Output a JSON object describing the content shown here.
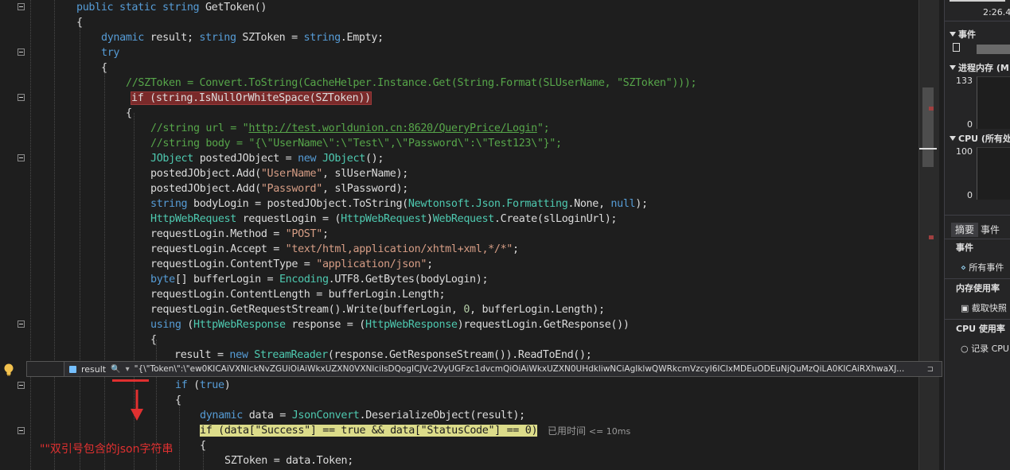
{
  "editor": {
    "lines": [
      [
        [
          "k",
          "public static "
        ],
        [
          "k",
          "string "
        ],
        [
          "p",
          "GetToken()"
        ]
      ],
      [
        [
          "p",
          "{"
        ]
      ],
      [
        [
          "k",
          "dynamic "
        ],
        [
          "p",
          "result; "
        ],
        [
          "k",
          "string "
        ],
        [
          "p",
          "SZToken = "
        ],
        [
          "k",
          "string"
        ],
        [
          "p",
          ".Empty;"
        ]
      ],
      [
        [
          "k",
          "try"
        ]
      ],
      [
        [
          "p",
          "{"
        ]
      ],
      [
        [
          "c",
          "//SZToken = Convert.ToString(CacheHelper.Instance.Get(String.Format(SLUserName, \"SZToken\")));"
        ]
      ],
      [
        [
          "hr",
          "if (string.IsNullOrWhiteSpace(SZToken))"
        ]
      ],
      [
        [
          "p",
          "{"
        ]
      ],
      [
        [
          "c",
          "//string url = \""
        ],
        [
          "u",
          "http://test.worldunion.cn:8620/QueryPrice/Login"
        ],
        [
          "c",
          "\";"
        ]
      ],
      [
        [
          "c",
          "//string body = \"{\\\"UserName\\\":\\\"Test\\\",\\\"Password\\\":\\\"Test123\\\"}\";"
        ]
      ],
      [
        [
          "t",
          "JObject "
        ],
        [
          "p",
          "postedJObject = "
        ],
        [
          "k",
          "new "
        ],
        [
          "t",
          "JObject"
        ],
        [
          "p",
          "();"
        ]
      ],
      [
        [
          "p",
          "postedJObject.Add("
        ],
        [
          "s",
          "\"UserName\""
        ],
        [
          "p",
          ", slUserName);"
        ]
      ],
      [
        [
          "p",
          "postedJObject.Add("
        ],
        [
          "s",
          "\"Password\""
        ],
        [
          "p",
          ", slPassword);"
        ]
      ],
      [
        [
          "k",
          "string "
        ],
        [
          "p",
          "bodyLogin = postedJObject.ToString("
        ],
        [
          "t",
          "Newtonsoft.Json.Formatting"
        ],
        [
          "p",
          ".None, "
        ],
        [
          "k",
          "null"
        ],
        [
          "p",
          ");"
        ]
      ],
      [
        [
          "t",
          "HttpWebRequest "
        ],
        [
          "p",
          "requestLogin = ("
        ],
        [
          "t",
          "HttpWebRequest"
        ],
        [
          "p",
          ")"
        ],
        [
          "t",
          "WebRequest"
        ],
        [
          "p",
          ".Create(slLoginUrl);"
        ]
      ],
      [
        [
          "p",
          "requestLogin.Method = "
        ],
        [
          "s",
          "\"POST\""
        ],
        [
          "p",
          ";"
        ]
      ],
      [
        [
          "p",
          "requestLogin.Accept = "
        ],
        [
          "s",
          "\"text/html,application/xhtml+xml,*/*\""
        ],
        [
          "p",
          ";"
        ]
      ],
      [
        [
          "p",
          "requestLogin.ContentType = "
        ],
        [
          "s",
          "\"application/json\""
        ],
        [
          "p",
          ";"
        ]
      ],
      [
        [
          "k",
          "byte"
        ],
        [
          "p",
          "[] bufferLogin = "
        ],
        [
          "t",
          "Encoding"
        ],
        [
          "p",
          ".UTF8.GetBytes(bodyLogin);"
        ]
      ],
      [
        [
          "p",
          "requestLogin.ContentLength = bufferLogin.Length;"
        ]
      ],
      [
        [
          "p",
          "requestLogin.GetRequestStream().Write(bufferLogin, "
        ],
        [
          "n",
          "0"
        ],
        [
          "p",
          ", bufferLogin.Length);"
        ]
      ],
      [
        [
          "k",
          "using "
        ],
        [
          "p",
          "("
        ],
        [
          "t",
          "HttpWebResponse "
        ],
        [
          "p",
          "response = ("
        ],
        [
          "t",
          "HttpWebResponse"
        ],
        [
          "p",
          ")requestLogin.GetResponse())"
        ]
      ],
      [
        [
          "p",
          "{"
        ]
      ],
      [
        [
          "p",
          "result = "
        ],
        [
          "k",
          "new "
        ],
        [
          "t",
          "StreamReader"
        ],
        [
          "p",
          "(response.GetResponseStream()).ReadToEnd();"
        ]
      ],
      [],
      [
        [
          "k",
          "if "
        ],
        [
          "p",
          "("
        ],
        [
          "k",
          "true"
        ],
        [
          "p",
          ")"
        ]
      ],
      [
        [
          "p",
          "{"
        ]
      ],
      [
        [
          "k",
          "dynamic "
        ],
        [
          "p",
          "data = "
        ],
        [
          "t",
          "JsonConvert"
        ],
        [
          "p",
          ".DeserializeObject(result);"
        ]
      ],
      [
        [
          "hy",
          "if (data[\"Success\"] == true && data[\"StatusCode\"] == 0)"
        ]
      ],
      [
        [
          "p",
          "{"
        ]
      ],
      [
        [
          "p",
          "SZToken = data.Token;"
        ]
      ]
    ],
    "elapsed_label": "已用时间",
    "elapsed_value": "<= 10ms"
  },
  "datatip": {
    "name": "result",
    "magnifier": "🔍",
    "dropdown": "▾",
    "value": "\"{\\\"Token\\\":\\\"ew0KICAiVXNlckNvZGUiOiAiWkxUZXN0VXNlciIsDQogICJVc2VyUGFzc1dvcmQiOiAiWkxUZXN0UHdkliwNCiAgIklwQWRkcmVzcyI6IClxMDEuODEuNjQuMzQiLA0KICAiRXhwaXJ...",
    "more": "⊐"
  },
  "annotation": "\"\"双引号包含的json字符串",
  "diagnostics": {
    "time_value": "2:26.4",
    "events_header": "事件",
    "process_memory_header": "进程内存 (M",
    "mem_max": "133",
    "mem_min": "0",
    "cpu_header": "CPU (所有处",
    "cpu_max": "100",
    "cpu_min": "0",
    "tabs": [
      "摘要",
      "事件"
    ],
    "section_events": "事件",
    "all_events": "所有事件",
    "section_memory": "内存使用率",
    "take_snapshot": "截取快照",
    "section_cpu": "CPU 使用率",
    "record_cpu": "记录 CPU"
  },
  "colors": {
    "keyword": "#569cd6",
    "type": "#4ec9b0",
    "string": "#d69d85",
    "comment": "#57a64a",
    "breakpoint_highlight": "#7a2a2a",
    "current_statement": "#dcdc8a",
    "annotation_red": "#e03030"
  }
}
